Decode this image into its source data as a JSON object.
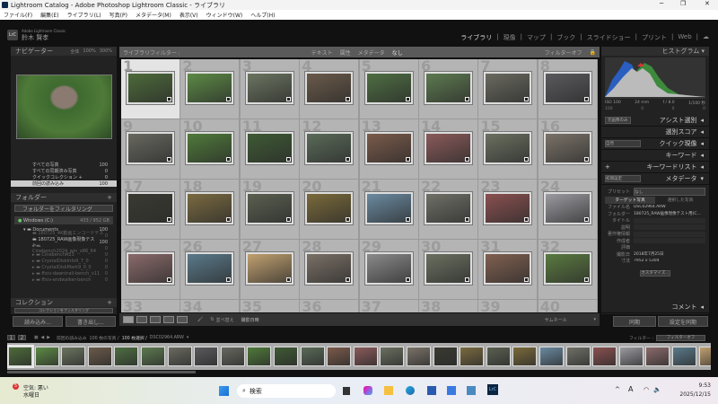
{
  "window": {
    "title": "Lightroom Catalog - Adobe Photoshop Lightroom Classic - ライブラリ",
    "app_icon": "LrC"
  },
  "menu": [
    "ファイル(F)",
    "編集(E)",
    "ライブラリ(L)",
    "写真(P)",
    "メタデータ(M)",
    "表示(V)",
    "ウィンドウ(W)",
    "ヘルプ(H)"
  ],
  "identity": {
    "product": "Adobe Lightroom Classic",
    "user": "鈴木 賢孝"
  },
  "modules": [
    "ライブラリ",
    "現像",
    "マップ",
    "ブック",
    "スライドショー",
    "プリント",
    "Web"
  ],
  "navigator": {
    "title": "ナビゲーター",
    "zoom_options": [
      "全体",
      "100%",
      "300%"
    ]
  },
  "catalog": [
    {
      "label": "すべての写真",
      "count": "100"
    },
    {
      "label": "すべての同期済み写真",
      "count": "0"
    },
    {
      "label": "クイックコレクション +",
      "count": "0"
    },
    {
      "label": "前回の読み込み",
      "count": "100"
    }
  ],
  "folders": {
    "title": "フォルダー",
    "filter": "フォルダーをフィルタリング",
    "volume": "Windows (C:)",
    "volume_size": "433 / 952 GB",
    "items": [
      {
        "label": "Documents",
        "count": "100"
      },
      {
        "label": "180725_4K動画エンコードテスト",
        "count": "0"
      },
      {
        "label": "180725_RAW画像現像テスト...",
        "count": "100"
      },
      {
        "label": "Cinebench2024_win_x86_64",
        "count": "0"
      },
      {
        "label": "CinebenchR23",
        "count": "0"
      },
      {
        "label": "CrystalDiskInfo9_7_0",
        "count": "0"
      },
      {
        "label": "CrystalDiskMark9_0_0",
        "count": "0"
      },
      {
        "label": "ffxiv-dawntrail-bench_v11",
        "count": "0"
      },
      {
        "label": "ffxiv-endwalker-bench",
        "count": "0"
      }
    ]
  },
  "collections": {
    "title": "コレクション",
    "item": "コレクションをフィルタリング"
  },
  "left_buttons": {
    "import": "読み込み...",
    "export": "書き出し..."
  },
  "library_filter": {
    "title": "ライブラリフィルター :",
    "options": [
      "テキスト",
      "属性",
      "メタデータ",
      "なし"
    ],
    "filter_off": "フィルターオフ"
  },
  "grid": {
    "thumbnails": [
      {
        "n": "1",
        "color": "#4d6b3a"
      },
      {
        "n": "2",
        "color": "#5c8a45"
      },
      {
        "n": "3",
        "color": "#6b7460"
      },
      {
        "n": "4",
        "color": "#6a5a4a"
      },
      {
        "n": "5",
        "color": "#4e6e42"
      },
      {
        "n": "6",
        "color": "#5d7a50"
      },
      {
        "n": "7",
        "color": "#6a6a60"
      },
      {
        "n": "8",
        "color": "#5a5a5e"
      },
      {
        "n": "9",
        "color": "#686860"
      },
      {
        "n": "10",
        "color": "#4f7a3a"
      },
      {
        "n": "11",
        "color": "#3e5a34"
      },
      {
        "n": "12",
        "color": "#5a6a58"
      },
      {
        "n": "13",
        "color": "#7a5a4a"
      },
      {
        "n": "14",
        "color": "#8a5a5a"
      },
      {
        "n": "15",
        "color": "#6a7060"
      },
      {
        "n": "16",
        "color": "#7a7268"
      },
      {
        "n": "17",
        "color": "#3a3a32"
      },
      {
        "n": "18",
        "color": "#7a6a40"
      },
      {
        "n": "19",
        "color": "#5a6050"
      },
      {
        "n": "20",
        "color": "#7a6a3a"
      },
      {
        "n": "21",
        "color": "#6a8aa0"
      },
      {
        "n": "22",
        "color": "#707068"
      },
      {
        "n": "23",
        "color": "#8a5050"
      },
      {
        "n": "24",
        "color": "#9a9aa0"
      },
      {
        "n": "25",
        "color": "#8a6a6a"
      },
      {
        "n": "26",
        "color": "#5a7a8a"
      },
      {
        "n": "27",
        "color": "#c0a070"
      },
      {
        "n": "28",
        "color": "#7a7066"
      },
      {
        "n": "29",
        "color": "#8a8a8a"
      },
      {
        "n": "30",
        "color": "#6a7060"
      },
      {
        "n": "31",
        "color": "#806050"
      },
      {
        "n": "32",
        "color": "#5a7a40"
      },
      {
        "n": "33",
        "color": "#888"
      },
      {
        "n": "34",
        "color": "#888"
      },
      {
        "n": "35",
        "color": "#888"
      },
      {
        "n": "36",
        "color": "#888"
      },
      {
        "n": "37",
        "color": "#888"
      },
      {
        "n": "38",
        "color": "#888"
      },
      {
        "n": "39",
        "color": "#888"
      },
      {
        "n": "40",
        "color": "#888"
      }
    ]
  },
  "toolbar": {
    "sort_label": "並べ替え",
    "sort_value": "撮影日時",
    "thumbnail_label": "サムネール"
  },
  "histogram": {
    "title": "ヒストグラム",
    "iso": "ISO 100",
    "focal": "24 mm",
    "aperture": "f / 8.0",
    "shutter": "1/100 秒",
    "counts": [
      "100",
      "0",
      "0",
      "0"
    ]
  },
  "right": {
    "original": "元画像のみ",
    "sections": [
      "アシスト選別",
      "選別スコア",
      "クイック現像",
      "キーワード",
      "キーワードリスト",
      "メタデータ"
    ],
    "quick_preset": "自然",
    "meta_preset_sel": "初期設定",
    "preset_label": "プリセット",
    "preset_value": "なし",
    "tabs": [
      "ターゲット写真",
      "選択した写真"
    ],
    "fields": [
      {
        "k": "ファイル名",
        "v": "DSC02964.ARW"
      },
      {
        "k": "フォルダー",
        "v": "180725_RAW画像現像テスト用(C..."
      },
      {
        "k": "タイトル",
        "v": ""
      },
      {
        "k": "説明",
        "v": ""
      },
      {
        "k": "著作権情報",
        "v": ""
      },
      {
        "k": "作成者",
        "v": ""
      },
      {
        "k": "評価",
        "v": ""
      },
      {
        "k": "撮影日",
        "v": "2018年7月25日"
      },
      {
        "k": "寸法",
        "v": "7952 x 5304"
      }
    ],
    "customize": "カスタマイズ...",
    "comment": "コメント",
    "sync": "同期",
    "sync_settings": "設定を同期"
  },
  "filmstrip": {
    "source": "前回の読み込み",
    "count": "100 枚の写真 /",
    "selected": "100 枚選択 /",
    "file": "DSC02964.ARW",
    "filter_label": "フィルター :",
    "filter_value": "フィルターオフ"
  },
  "taskbar": {
    "weather": "空気: 悪い",
    "weather_day": "水曜日",
    "weather_badge": "5",
    "search": "検索",
    "time": "9:53",
    "date": "2025/12/15",
    "ime": "A"
  }
}
